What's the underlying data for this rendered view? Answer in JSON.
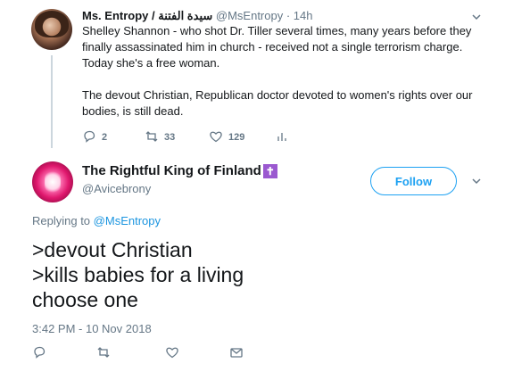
{
  "parent_tweet": {
    "author_name": "Ms. Entropy / سيدة الفتنة",
    "handle_time": "@MsEntropy · 14h",
    "paragraph_1": "Shelley Shannon - who shot Dr. Tiller several times, many years before they finally assassinated him in church - received not a single terrorism charge. Today she's a free woman.",
    "paragraph_2": "The devout Christian, Republican doctor devoted to women's rights over our bodies, is still dead.",
    "replies_count": "2",
    "retweets_count": "33",
    "likes_count": "129"
  },
  "main_tweet": {
    "author_name": "The Rightful King of Finland",
    "badge_glyph": "✝",
    "handle": "@Avicebrony",
    "follow_label": "Follow",
    "replying_prefix": "Replying to",
    "replying_mention": "@MsEntropy",
    "lines": [
      ">devout Christian",
      ">kills babies for a living",
      "choose one"
    ],
    "timestamp": "3:42 PM - 10 Nov 2018"
  },
  "colors": {
    "accent": "#1da1f2",
    "secondary_text": "#657786",
    "badge": "#9b59d0"
  },
  "icons": {
    "reply": "reply-icon",
    "retweet": "retweet-icon",
    "like": "heart-icon",
    "analytics": "analytics-icon",
    "dm": "envelope-icon",
    "menu": "chevron-down-icon"
  }
}
